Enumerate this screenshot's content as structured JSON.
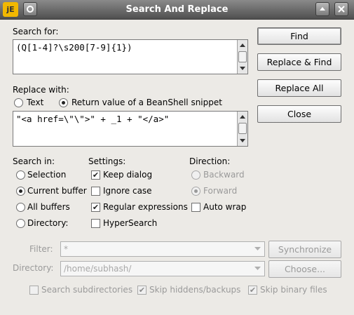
{
  "window": {
    "title": "Search And Replace",
    "app_icon_text": "jE"
  },
  "search": {
    "label": "Search for:",
    "value": "(Q[1-4]?\\s200[7-9]{1})"
  },
  "replace": {
    "label": "Replace with:",
    "mode_text": "Text",
    "mode_beanshell": "Return value of a BeanShell snippet",
    "selected_mode": "beanshell",
    "value": "\"<a href=\\\"\\\">\" + _1 + \"</a>\""
  },
  "buttons": {
    "find": "Find",
    "replace_find": "Replace & Find",
    "replace_all": "Replace All",
    "close": "Close"
  },
  "search_in": {
    "heading": "Search in:",
    "options": [
      "Selection",
      "Current buffer",
      "All buffers",
      "Directory:"
    ],
    "selected": "Current buffer"
  },
  "settings": {
    "heading": "Settings:",
    "keep_dialog": "Keep dialog",
    "ignore_case": "Ignore case",
    "regular_expressions": "Regular expressions",
    "hypersearch": "HyperSearch",
    "keep_dialog_checked": true,
    "ignore_case_checked": false,
    "regular_expressions_checked": true,
    "hypersearch_checked": false
  },
  "direction": {
    "heading": "Direction:",
    "backward": "Backward",
    "forward": "Forward",
    "auto_wrap": "Auto wrap",
    "selected": "Forward",
    "auto_wrap_checked": false
  },
  "filter": {
    "label": "Filter:",
    "value": "*",
    "synchronize": "Synchronize"
  },
  "directory": {
    "label": "Directory:",
    "value": "/home/subhash/",
    "choose": "Choose..."
  },
  "options": {
    "search_subdirectories": "Search subdirectories",
    "skip_hidden": "Skip hiddens/backups",
    "skip_binary": "Skip binary files",
    "search_subdirectories_checked": false,
    "skip_hidden_checked": true,
    "skip_binary_checked": true
  }
}
